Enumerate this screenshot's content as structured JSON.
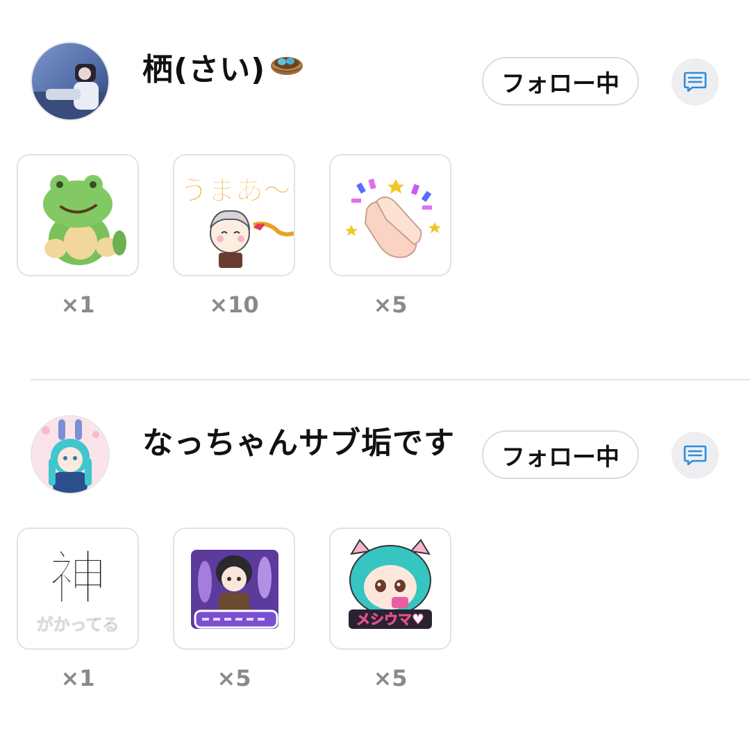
{
  "users": [
    {
      "name": "栖(さい)",
      "follow_label": "フォロー中",
      "gifts": [
        {
          "icon": "frog-plush-sticker",
          "count": "×1"
        },
        {
          "icon": "umaa-chibi-sticker",
          "count": "×10"
        },
        {
          "icon": "clapping-hands-sticker",
          "count": "×5"
        }
      ]
    },
    {
      "name": "なっちゃんサブ垢です",
      "follow_label": "フォロー中",
      "gifts": [
        {
          "icon": "kami-kanji-sticker",
          "count": "×1"
        },
        {
          "icon": "wisteria-chibi-sticker",
          "count": "×5"
        },
        {
          "icon": "meshiuma-chibi-sticker",
          "count": "×5"
        }
      ]
    }
  ],
  "stickers": {
    "umaa_text": "うまあ〜〜",
    "kami_text": "神",
    "kami_sub": "がかってる",
    "meshiuma_text": "メシウマ♥"
  },
  "colors": {
    "message_icon": "#2a8ce0",
    "count_text": "#8a8a8a"
  }
}
